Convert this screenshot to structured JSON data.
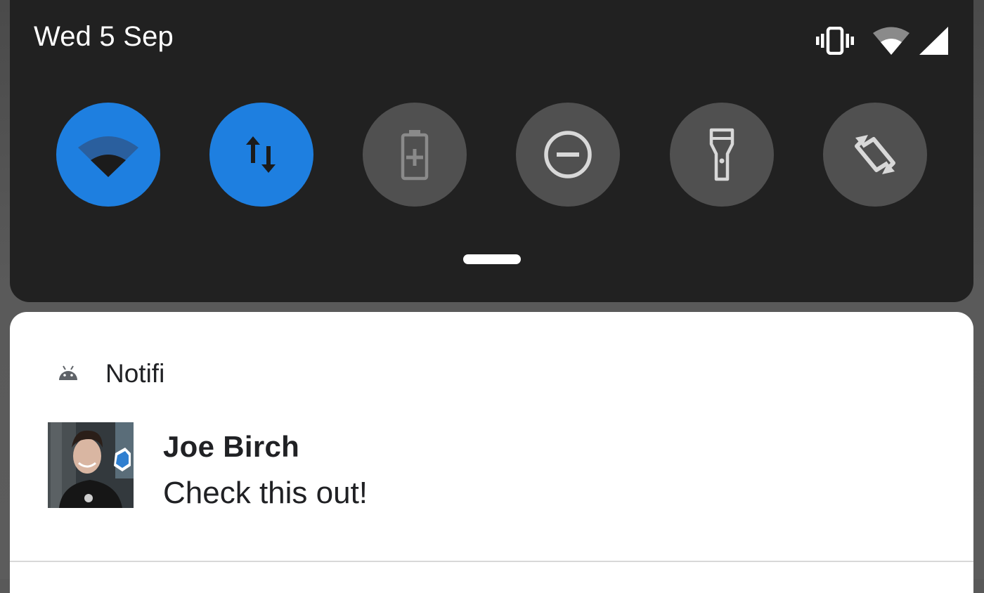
{
  "status_bar": {
    "date": "Wed 5 Sep",
    "icons": [
      "vibrate-icon",
      "wifi-signal-icon",
      "cellular-signal-icon"
    ]
  },
  "quick_settings": {
    "tiles": [
      {
        "icon": "wifi-icon",
        "state": "on"
      },
      {
        "icon": "mobile-data-icon",
        "state": "on"
      },
      {
        "icon": "battery-saver-icon",
        "state": "off"
      },
      {
        "icon": "do-not-disturb-icon",
        "state": "off"
      },
      {
        "icon": "flashlight-icon",
        "state": "off"
      },
      {
        "icon": "auto-rotate-icon",
        "state": "off"
      }
    ],
    "active_color": "#1e7fe0",
    "inactive_color": "#505050"
  },
  "notification": {
    "app_name": "Notifi",
    "app_icon": "android-icon",
    "sender": "Joe Birch",
    "message": "Check this out!"
  }
}
